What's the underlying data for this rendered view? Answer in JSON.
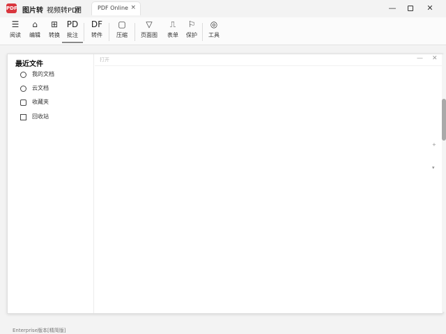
{
  "app": {
    "logo_text": "PDF"
  },
  "titlebar": {
    "menus": [
      "图片转",
      "视频转PDF",
      "图 "
    ],
    "tab_label": "PDF Online",
    "tab_close": "×",
    "minimize": "—",
    "close": "✕"
  },
  "toolbar": {
    "items": [
      {
        "icon": "☰",
        "label": "阅读"
      },
      {
        "icon": "⌂",
        "label": "编辑"
      },
      {
        "icon": "⊞",
        "label": "转换"
      },
      {
        "text": "PD",
        "label": "批注"
      },
      {
        "text": "DF",
        "label": "转件"
      },
      {
        "icon": "▢",
        "label": "压缩"
      },
      {
        "icon": "▽",
        "label": "页面图"
      },
      {
        "icon": "⎍",
        "label": "表单"
      },
      {
        "icon": "⚐",
        "label": "保护"
      },
      {
        "icon": "◎",
        "label": "工具"
      }
    ]
  },
  "sidebar": {
    "title": "最近文件",
    "items": [
      {
        "label": "我的文档",
        "icon": "circle"
      },
      {
        "label": "云文档",
        "icon": "circle"
      },
      {
        "label": "收藏夹",
        "icon": "rounded"
      },
      {
        "label": "回收站",
        "icon": "square"
      }
    ]
  },
  "content": {
    "title": "打开",
    "min": "—",
    "close": "✕",
    "arrow_up": "+",
    "arrow_down": "▾"
  },
  "statusbar": {
    "text": "Enterprise版本[精简版]"
  }
}
